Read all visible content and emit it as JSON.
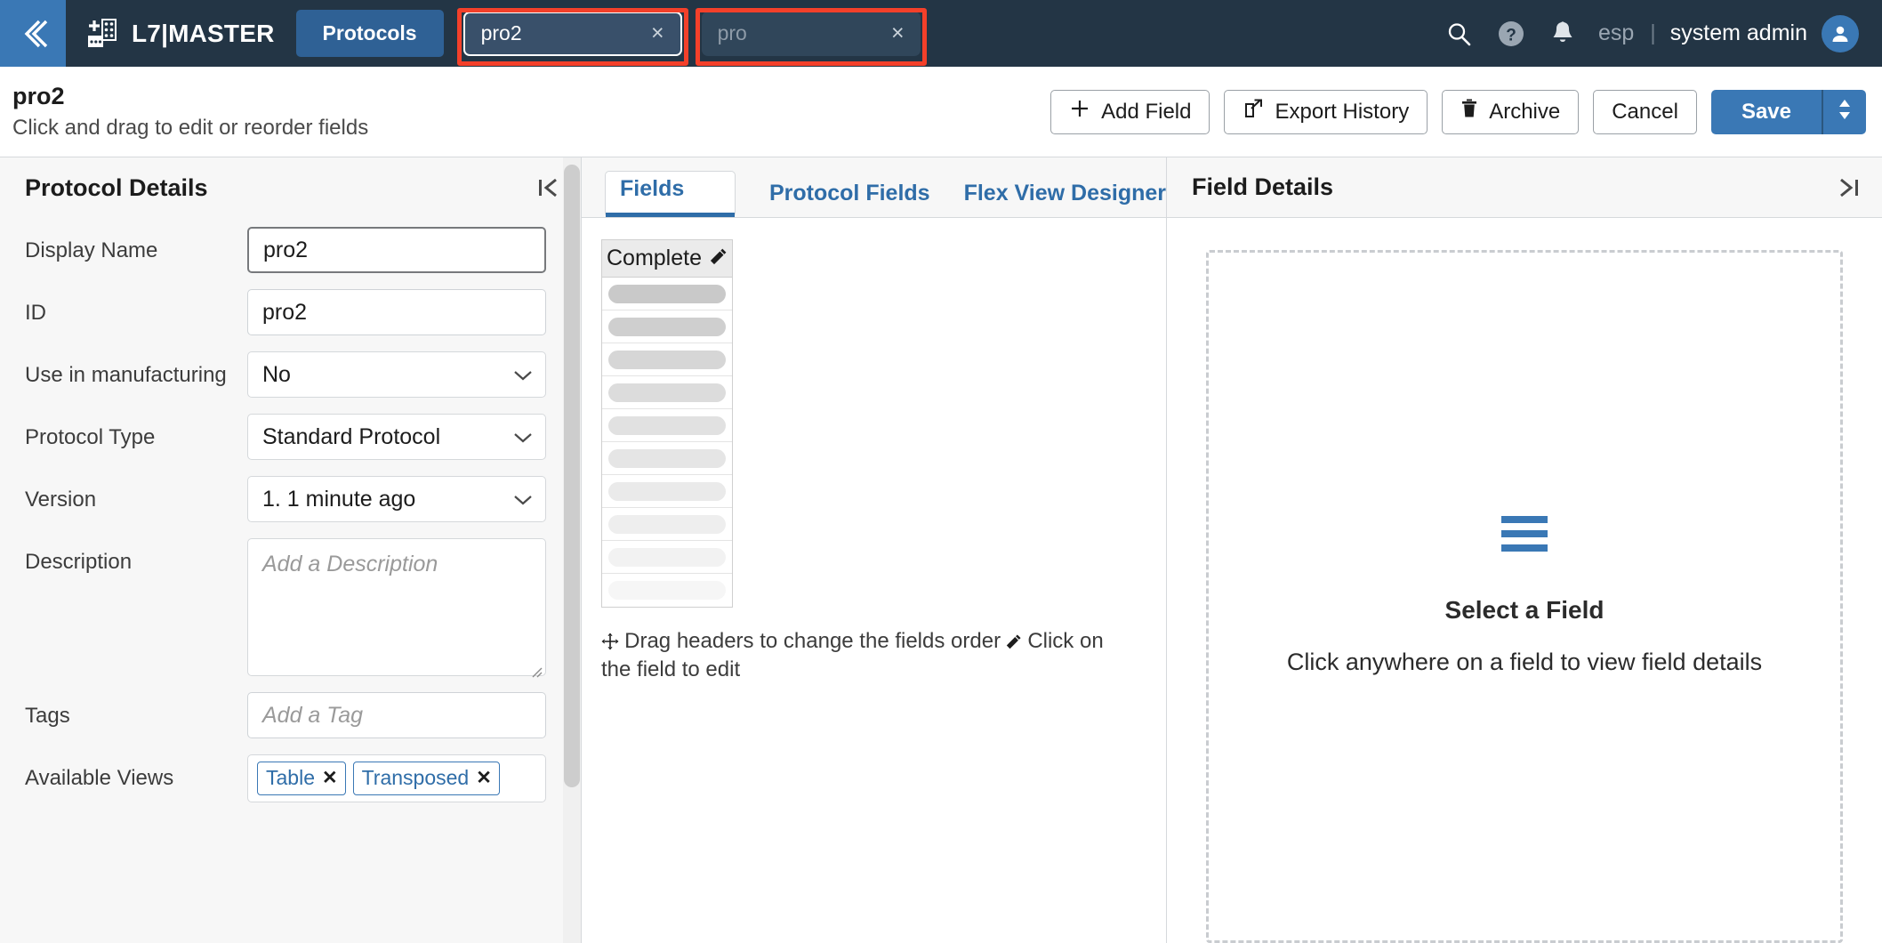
{
  "header": {
    "back_icon": "double-chevron-left-icon",
    "logo_icon": "microplate-add-icon",
    "brand": "L7|MASTER",
    "nav_pill": "Protocols",
    "tabs": [
      {
        "value": "pro2",
        "placeholder": "",
        "close": "×",
        "active": true,
        "highlighted": true
      },
      {
        "value": "",
        "placeholder": "pro",
        "close": "×",
        "active": false,
        "highlighted": true
      }
    ],
    "search_icon": "search-icon",
    "help_icon": "help-circle-icon",
    "bell_icon": "bell-icon",
    "language": "esp",
    "separator": "|",
    "user": "system admin",
    "avatar_icon": "user-avatar-icon",
    "accent": "#3a78b5",
    "bar_color": "#233545",
    "annotation_color": "#f4402a"
  },
  "actionbar": {
    "title": "pro2",
    "subtitle": "Click and drag to edit or reorder fields",
    "buttons": [
      {
        "label": "Add Field",
        "icon": "plus-icon"
      },
      {
        "label": "Export History",
        "icon": "external-link-icon"
      },
      {
        "label": "Archive",
        "icon": "trash-icon"
      },
      {
        "label": "Cancel",
        "icon": ""
      }
    ],
    "save_label": "Save",
    "save_split_icon": "updown-caret-icon"
  },
  "left_panel": {
    "title": "Protocol Details",
    "collapse_icon": "collapse-left-icon",
    "fields": [
      {
        "label": "Display Name",
        "type": "input",
        "value": "pro2",
        "placeholder": "",
        "focused": true
      },
      {
        "label": "ID",
        "type": "input",
        "value": "pro2",
        "placeholder": "",
        "focused": false
      },
      {
        "label": "Use in manufacturing",
        "type": "select",
        "value": "No"
      },
      {
        "label": "Protocol Type",
        "type": "select",
        "value": "Standard Protocol"
      },
      {
        "label": "Version",
        "type": "select",
        "value": "1. 1 minute ago"
      },
      {
        "label": "Description",
        "type": "textarea",
        "value": "",
        "placeholder": "Add a Description"
      },
      {
        "label": "Tags",
        "type": "input",
        "value": "",
        "placeholder": "Add a Tag",
        "focused": false
      },
      {
        "label": "Available Views",
        "type": "chips",
        "chips": [
          "Table",
          "Transposed"
        ],
        "chip_close": "✕"
      }
    ]
  },
  "mid_panel": {
    "tabs": [
      {
        "label": "Fields",
        "selected": true
      },
      {
        "label": "Protocol Fields",
        "selected": false
      },
      {
        "label": "Flex View Designer",
        "selected": false
      }
    ],
    "field_list": {
      "header": "Complete",
      "header_icon": "pencil-icon",
      "skeleton_rows": 10,
      "skeleton_shades": [
        "#c9c9c9",
        "#cfcfcf",
        "#d6d6d6",
        "#dcdcdc",
        "#e1e1e1",
        "#e5e5e5",
        "#eaeaea",
        "#eeeeee",
        "#f2f2f2",
        "#f6f6f6"
      ]
    },
    "hint_drag_icon": "move-arrows-icon",
    "hint_drag": "Drag headers to change the fields order",
    "hint_edit_icon": "pencil-icon",
    "hint_edit": "Click on the field to edit"
  },
  "right_panel": {
    "title": "Field Details",
    "expand_icon": "collapse-right-icon",
    "empty_icon": "three-bars-icon",
    "empty_title": "Select a Field",
    "empty_subtitle": "Click anywhere on a field to view field details",
    "icon_color": "#3a78b5"
  }
}
